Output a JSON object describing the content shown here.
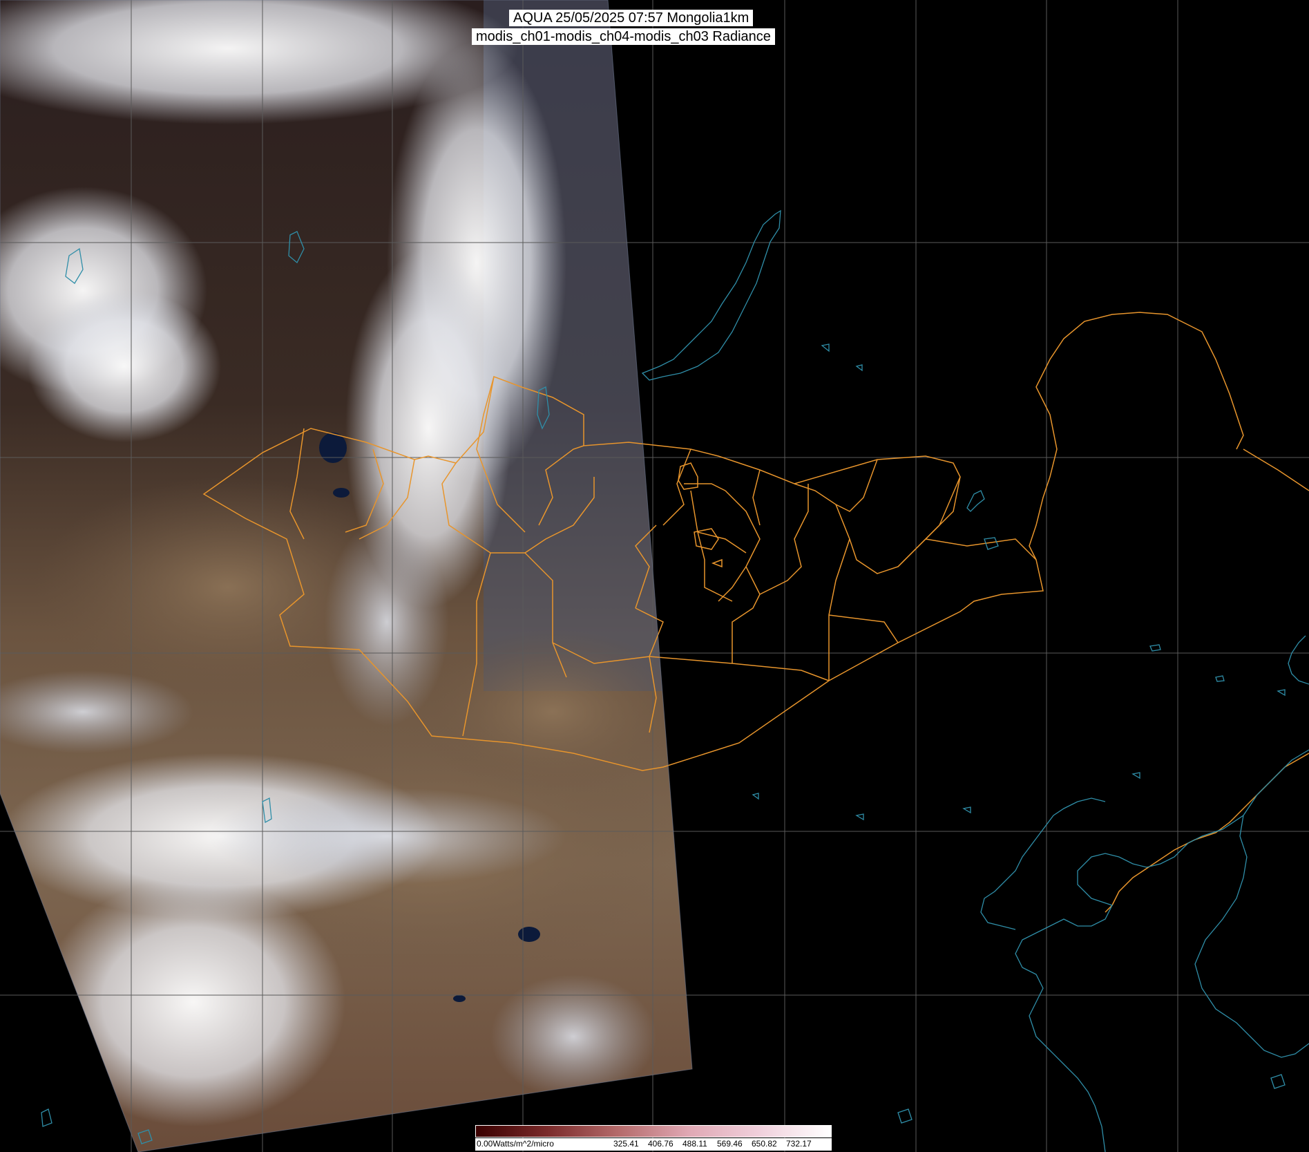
{
  "title": {
    "line1": "AQUA 25/05/2025 07:57 Mongolia1km",
    "line2": "modis_ch01-modis_ch04-modis_ch03 Radiance"
  },
  "map": {
    "satellite": "AQUA",
    "region": "Mongolia1km",
    "date": "25/05/2025",
    "time": "07:57",
    "composite": "modis_ch01-modis_ch04-modis_ch03 Radiance",
    "graticule_color": "#5a5a5a",
    "admin_boundary_color": "#e8952c",
    "coastline_color": "#2f8ea8",
    "background_color": "#000000"
  },
  "colorbar": {
    "colors": [
      "#3a0000",
      "#7a2a2a",
      "#b46a6a",
      "#e0a8b4",
      "#f0d0dc",
      "#ffffff"
    ],
    "labels": [
      "0.00Watts/m^2/micro",
      "325.41",
      "406.76",
      "488.11",
      "569.46",
      "650.82",
      "732.17"
    ]
  }
}
